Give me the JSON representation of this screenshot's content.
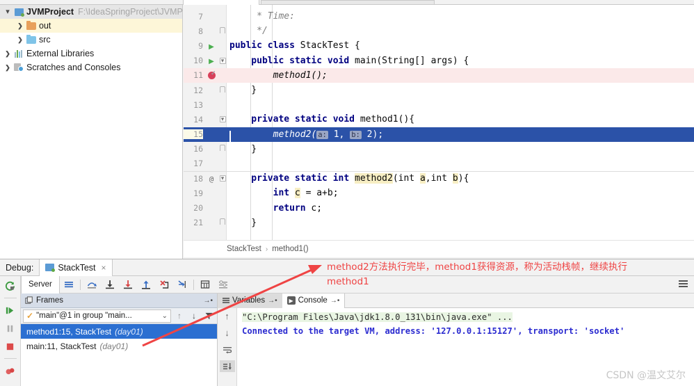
{
  "project_tree": {
    "items": [
      {
        "label": "JVMProject",
        "path": "F:\\IdeaSpringProject\\JVMP",
        "icon": "module-icon",
        "arrow": "down",
        "state": "selected-grey",
        "indent": 0
      },
      {
        "label": "out",
        "path": "",
        "icon": "folder-orange-icon",
        "arrow": "right",
        "state": "selected-yellow",
        "indent": 1
      },
      {
        "label": "src",
        "path": "",
        "icon": "folder-blue-icon",
        "arrow": "right",
        "state": "none",
        "indent": 1
      },
      {
        "label": "External Libraries",
        "path": "",
        "icon": "libraries-icon",
        "arrow": "right",
        "state": "none",
        "indent": 0
      },
      {
        "label": "Scratches and Consoles",
        "path": "",
        "icon": "scratches-icon",
        "arrow": "right",
        "state": "none",
        "indent": 0
      }
    ]
  },
  "editor": {
    "breadcrumb": {
      "class": "StackTest",
      "separator": "›",
      "method": "method1()"
    },
    "lines": [
      {
        "num": "7",
        "gutter": "",
        "fold": "",
        "state": "normal",
        "tokens": [
          {
            "t": "     * Time:",
            "c": "cm"
          }
        ]
      },
      {
        "num": "8",
        "gutter": "",
        "fold": "fold-cap",
        "state": "normal",
        "tokens": [
          {
            "t": "     */",
            "c": "cm"
          }
        ]
      },
      {
        "num": "9",
        "gutter": "run",
        "fold": "",
        "state": "normal",
        "tokens": [
          {
            "t": "public class ",
            "c": "kw"
          },
          {
            "t": "StackTest {",
            "c": ""
          }
        ]
      },
      {
        "num": "10",
        "gutter": "run",
        "fold": "fold-box",
        "state": "normal",
        "tokens": [
          {
            "t": "    public static void ",
            "c": "kw"
          },
          {
            "t": "main(String[] args) {",
            "c": ""
          }
        ]
      },
      {
        "num": "11",
        "gutter": "breakpoint",
        "fold": "",
        "state": "breakpoint",
        "tokens": [
          {
            "t": "        method1();",
            "c": "mth"
          }
        ]
      },
      {
        "num": "12",
        "gutter": "",
        "fold": "fold-cap",
        "state": "normal",
        "tokens": [
          {
            "t": "    }",
            "c": ""
          }
        ]
      },
      {
        "num": "13",
        "gutter": "",
        "fold": "",
        "state": "normal",
        "tokens": [
          {
            "t": "",
            "c": ""
          }
        ]
      },
      {
        "num": "14",
        "gutter": "",
        "fold": "fold-box",
        "state": "normal",
        "tokens": [
          {
            "t": "    private static void ",
            "c": "kw"
          },
          {
            "t": "method1(){",
            "c": ""
          }
        ]
      },
      {
        "num": "15",
        "gutter": "",
        "fold": "",
        "state": "selected",
        "tokens": [
          {
            "t": "        method2(",
            "c": "mth"
          },
          {
            "t": "a:",
            "c": "hint"
          },
          {
            "t": " 1, ",
            "c": ""
          },
          {
            "t": "b:",
            "c": "hint"
          },
          {
            "t": " 2);",
            "c": ""
          }
        ]
      },
      {
        "num": "16",
        "gutter": "",
        "fold": "fold-cap",
        "state": "normal",
        "tokens": [
          {
            "t": "    }",
            "c": ""
          }
        ]
      },
      {
        "num": "17",
        "gutter": "",
        "fold": "",
        "state": "normal",
        "tokens": [
          {
            "t": "",
            "c": ""
          }
        ]
      },
      {
        "num": "18",
        "gutter": "at",
        "fold": "fold-box",
        "state": "separator",
        "tokens": [
          {
            "t": "    private static int ",
            "c": "kw"
          },
          {
            "t": "method2",
            "c": "hl"
          },
          {
            "t": "(int ",
            "c": ""
          },
          {
            "t": "a",
            "c": "hl"
          },
          {
            "t": ",int ",
            "c": ""
          },
          {
            "t": "b",
            "c": "hl"
          },
          {
            "t": "){",
            "c": ""
          }
        ]
      },
      {
        "num": "19",
        "gutter": "",
        "fold": "",
        "state": "normal",
        "tokens": [
          {
            "t": "        int ",
            "c": "kw"
          },
          {
            "t": "c",
            "c": "hl"
          },
          {
            "t": " = a+b;",
            "c": ""
          }
        ]
      },
      {
        "num": "20",
        "gutter": "",
        "fold": "",
        "state": "normal",
        "tokens": [
          {
            "t": "        return ",
            "c": "kw"
          },
          {
            "t": "c;",
            "c": ""
          }
        ]
      },
      {
        "num": "21",
        "gutter": "",
        "fold": "fold-cap",
        "state": "normal",
        "tokens": [
          {
            "t": "    }",
            "c": ""
          }
        ]
      }
    ]
  },
  "debug": {
    "label": "Debug:",
    "tab_title": "StackTest",
    "tab_close": "×",
    "side_buttons": [
      {
        "name": "rerun-button",
        "glyph": "rerun"
      },
      {
        "name": "resume-program-button",
        "glyph": "resume"
      },
      {
        "name": "pause-program-button",
        "glyph": "pause"
      },
      {
        "name": "stop-button",
        "glyph": "stop"
      },
      {
        "name": "mute-breakpoints-button",
        "glyph": "mute"
      }
    ],
    "toolbar": {
      "server_tab": "Server",
      "buttons": [
        {
          "name": "show-execution-point-button",
          "glyph": "exec-point"
        },
        {
          "name": "step-over-button",
          "glyph": "step-over"
        },
        {
          "name": "step-into-button",
          "glyph": "step-into"
        },
        {
          "name": "force-step-into-button",
          "glyph": "force-step-into"
        },
        {
          "name": "step-out-button",
          "glyph": "step-out"
        },
        {
          "name": "drop-frame-button",
          "glyph": "drop-frame"
        },
        {
          "name": "run-to-cursor-button",
          "glyph": "run-to-cursor"
        },
        {
          "name": "evaluate-expression-button",
          "glyph": "evaluate"
        },
        {
          "name": "settings-button",
          "glyph": "settings"
        }
      ]
    },
    "frames": {
      "title": "Frames",
      "pin": "→•",
      "thread": "\"main\"@1 in group \"main...",
      "thread_check": "✓",
      "dropdown_caret": "⌄",
      "nav_up": "↑",
      "nav_down": "↓",
      "filter": "filter-icon",
      "rows": [
        {
          "text": "method1:15, StackTest",
          "module": "(day01)",
          "active": true
        },
        {
          "text": "main:11, StackTest",
          "module": "(day01)",
          "active": false
        }
      ]
    },
    "console": {
      "tabs": [
        {
          "label": "Variables",
          "pin": "→•",
          "icon": "variables-icon",
          "active": false
        },
        {
          "label": "Console",
          "pin": "→•",
          "icon": "console-icon",
          "active": true
        }
      ],
      "gutter_buttons": [
        {
          "name": "scroll-up-button",
          "glyph": "↑",
          "on": false
        },
        {
          "name": "scroll-down-button",
          "glyph": "↓",
          "on": false
        },
        {
          "name": "soft-wrap-button",
          "glyph": "wrap",
          "on": false
        },
        {
          "name": "scroll-to-end-button",
          "glyph": "scroll-end",
          "on": true
        }
      ],
      "lines": [
        {
          "text": "\"C:\\Program Files\\Java\\jdk1.8.0_131\\bin\\java.exe\" ...",
          "type": "cmd"
        },
        {
          "text": "Connected to the target VM, address: '127.0.0.1:15127', transport: 'socket'",
          "type": "info"
        }
      ]
    }
  },
  "annotation": {
    "line1": "method2方法执行完毕，method1获得资源，称为活动栈帧，继续执行",
    "line2": "method1",
    "color": "#ef4444"
  },
  "watermark": "CSDN @温文艾尔"
}
